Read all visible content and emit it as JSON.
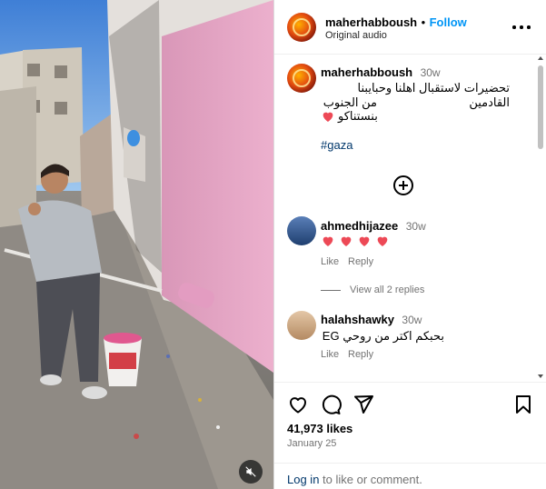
{
  "post": {
    "author": "maherhabboush",
    "dot": "•",
    "follow_label": "Follow",
    "audio": "Original audio",
    "caption_age": "30w",
    "caption_lines": [
      "تحضيرات لاستقبال اهلنا وحبايبنا القادمين",
      "من الجنوب",
      "بنستناكو"
    ],
    "caption_emoji": "heart",
    "hashtag": "#gaza"
  },
  "comments": [
    {
      "user": "ahmedhijazee",
      "age": "30w",
      "body_emoji": [
        "heart",
        "heart",
        "heart",
        "heart"
      ],
      "like_label": "Like",
      "reply_label": "Reply",
      "view_replies": "View all 2 replies"
    },
    {
      "user": "halahshawky",
      "age": "30w",
      "text": "بحبكم اكتر من روحي EG",
      "like_label": "Like",
      "reply_label": "Reply"
    }
  ],
  "stats": {
    "likes": "41,973 likes",
    "date": "January 25"
  },
  "footer": {
    "login_link": "Log in",
    "login_rest": " to like or comment."
  },
  "colors": {
    "accent": "#0095f6",
    "link": "#00376b",
    "heart": "#ed4956",
    "wall_pink": "#e7a3c3"
  },
  "icons": [
    "more-options-icon",
    "add-comment-icon",
    "like-icon",
    "comment-icon",
    "share-icon",
    "save-icon",
    "audio-muted-icon"
  ]
}
